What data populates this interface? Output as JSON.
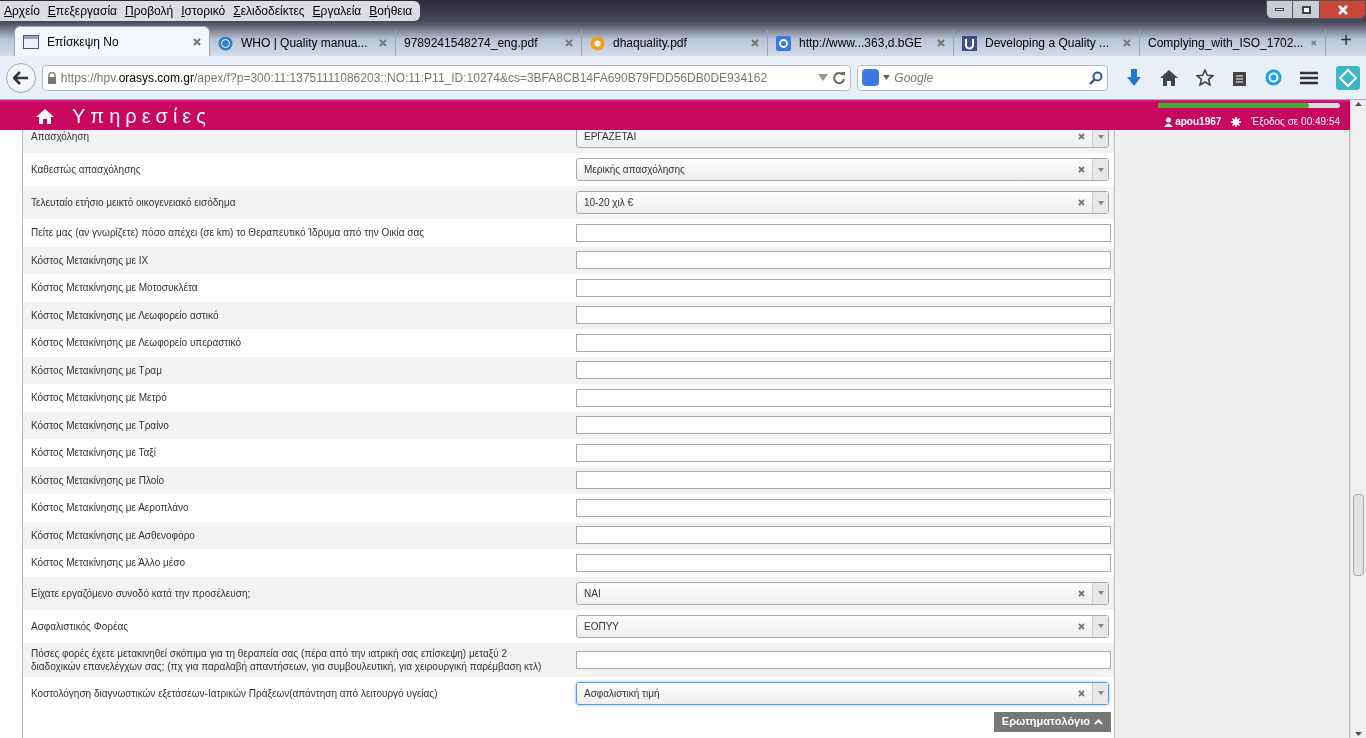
{
  "menu_bar": [
    "Αρχείο",
    "Επεξεργασία",
    "Προβολή",
    "Ιστορικό",
    "Σελιδοδείκτες",
    "Εργαλεία",
    "Βοήθεια"
  ],
  "tabs": [
    {
      "label": "Επίσκεψη Νο",
      "selected": true,
      "kind": "page"
    },
    {
      "label": "WHO | Quality manua...",
      "selected": false,
      "kind": "globe"
    },
    {
      "label": "9789241548274_eng.pdf",
      "selected": false,
      "kind": "none"
    },
    {
      "label": "dhaquality.pdf",
      "selected": false,
      "kind": "orange"
    },
    {
      "label": "http://www...363,d.bGE",
      "selected": false,
      "kind": "g"
    },
    {
      "label": "Developing a Quality ...",
      "selected": false,
      "kind": "u"
    },
    {
      "label": "Complying_with_ISO_1702...",
      "selected": false,
      "kind": "none"
    }
  ],
  "address_bar": {
    "prefix": "https://hpv.",
    "domain": "orasys.com.gr",
    "path": "/apex/f?p=300:11:13751111086203::NO:11:P11_ID:10274&cs=3BFA8CB14FA690B79FDD56DB0DE934162"
  },
  "search": {
    "placeholder": "Google"
  },
  "header": {
    "title": "Υπηρεσίες",
    "user": "apou1967",
    "session": "Έξοδος σε 00:49:54",
    "session_bar": {
      "level": 0.83
    }
  },
  "form_rows": [
    {
      "label": "Απασχόληση",
      "kind": "select",
      "value": "ΕΡΓΑΖΕΤΑΙ",
      "focused": false
    },
    {
      "label": "Καθεστώς απασχόλησης",
      "kind": "select",
      "value": "Μερικής απασχόλησης",
      "focused": false
    },
    {
      "label": "Τελευταίο ετήσιο μεικτό οικογενειακό εισόδημα",
      "kind": "select",
      "value": "10-20 χιλ €",
      "focused": false
    },
    {
      "label": "Πείτε μας (αν γνωρίζετε) πόσο απέχει (σε km) το Θεραπευτικό Ίδρυμα από την Οικία σας",
      "kind": "text",
      "focused": false
    },
    {
      "label": "Κόστος Μετακίνησης με ΙΧ",
      "kind": "text",
      "focused": false
    },
    {
      "label": "Κόστος Μετακίνησης με Μοτοσυκλέτα",
      "kind": "text",
      "focused": false
    },
    {
      "label": "Κόστος Μετακίνησης με Λεωφορείο αστικό",
      "kind": "text",
      "focused": false
    },
    {
      "label": "Κόστος Μετακίνησης με Λεωφορείο υπεραστικό",
      "kind": "text",
      "focused": false
    },
    {
      "label": "Κόστος Μετακίνησης με Τραμ",
      "kind": "text",
      "focused": false
    },
    {
      "label": "Κόστος Μετακίνησης με Μετρό",
      "kind": "text",
      "focused": false
    },
    {
      "label": "Κόστος Μετακίνησης με Τραίνο",
      "kind": "text",
      "focused": false
    },
    {
      "label": "Κόστος Μετακίνησης με Ταξί",
      "kind": "text",
      "focused": false
    },
    {
      "label": "Κόστος Μετακίνησης με Πλοίο",
      "kind": "text",
      "focused": false
    },
    {
      "label": "Κόστος Μετακίνησης με Αεροπλάνο",
      "kind": "text",
      "focused": false
    },
    {
      "label": "Κόστος Μετακίνησης με Ασθενοφόρο",
      "kind": "text",
      "focused": false
    },
    {
      "label": "Κόστος Μετακίνησης με Άλλο μέσο",
      "kind": "text",
      "focused": false
    },
    {
      "label": "Είχατε εργαζόμενο συνοδό κατά την προσέλευση;",
      "kind": "select",
      "value": "ΝΑΙ",
      "focused": false
    },
    {
      "label": "Ασφαλιστικός Φορέας",
      "kind": "select",
      "value": "ΕΟΠΥΥ",
      "focused": false
    },
    {
      "label": "Πόσες φορές έχετε μετακινηθεί σκόπιμα για τη θεραπεία σας (πέρα από την ιατρική σας επίσκεψη) μεταξύ 2 διαδοχικών επανελέγχων σας; (πχ για παραλαβή απαντήσεων, για συμβουλευτική, για χειρουργική παρέμβαση κτλ)",
      "kind": "text",
      "focused": false
    },
    {
      "label": "Κοστολόγηση διαγνωστικών εξετάσεων-Ιατρικών Πράξεων(απάντηση από λειτουργό υγείας)",
      "kind": "select",
      "value": "Ασφαλιστική τιμή",
      "focused": true
    }
  ],
  "footer_button": "Ερωτηματολόγιο",
  "new_tab_button": "+"
}
